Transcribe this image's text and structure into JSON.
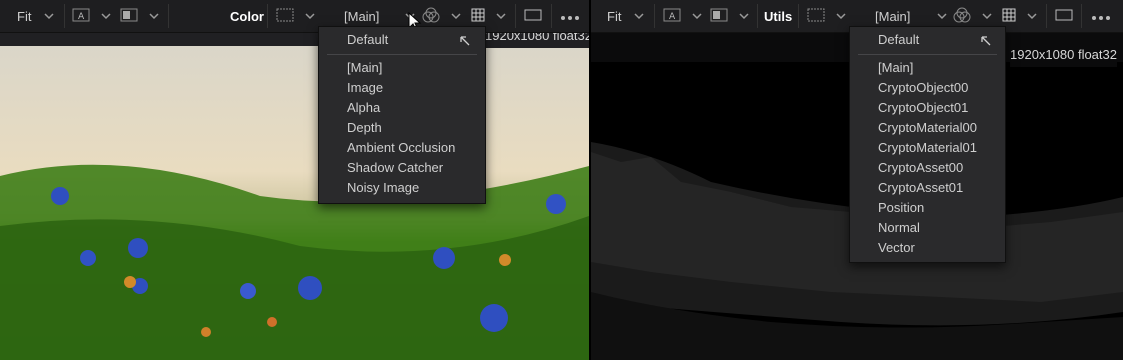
{
  "left_viewer": {
    "toolbar": {
      "fit_label": "Fit",
      "mode_label": "Color",
      "channel_value": "[Main]"
    },
    "resolution": "1920x1080 float32",
    "channel_menu": {
      "default_label": "Default",
      "items": [
        "[Main]",
        "Image",
        "Alpha",
        "Depth",
        "Ambient Occlusion",
        "Shadow Catcher",
        "Noisy Image"
      ]
    }
  },
  "right_viewer": {
    "toolbar": {
      "fit_label": "Fit",
      "mode_label": "Utils",
      "channel_value": "[Main]"
    },
    "resolution": "1920x1080 float32",
    "channel_menu": {
      "default_label": "Default",
      "items": [
        "[Main]",
        "CryptoObject00",
        "CryptoObject01",
        "CryptoMaterial00",
        "CryptoMaterial01",
        "CryptoAsset00",
        "CryptoAsset01",
        "Position",
        "Normal",
        "Vector"
      ]
    }
  },
  "icons": [
    "chevron-down-icon",
    "a-box-icon",
    "compare-icon",
    "color-wheel-icon",
    "grid-icon",
    "frame-icon",
    "more-icon",
    "return-arrow-icon",
    "mouse-cursor-icon"
  ],
  "colors": {
    "toolbar_bg": "#1e1e20",
    "menu_bg": "#2a2a2c",
    "text": "#cfcfcf"
  }
}
